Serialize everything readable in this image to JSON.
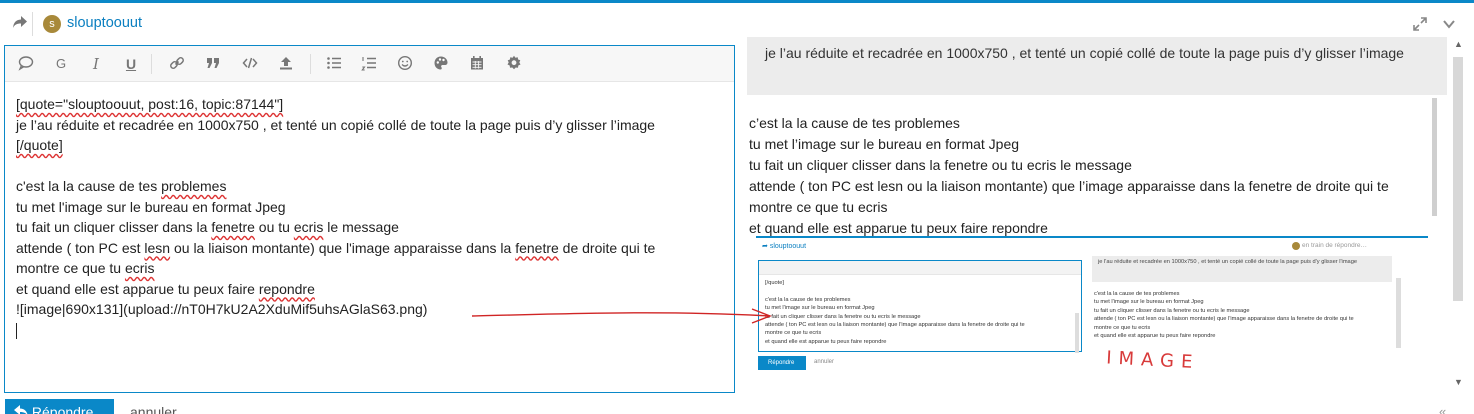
{
  "header": {
    "avatar_letter": "s",
    "username": "slouptoouut",
    "avatar_color": "#a8893a",
    "accent_color": "#0a88c8"
  },
  "toolbar": {
    "icons": [
      "speech-bubble-icon",
      "g-icon",
      "italic-icon",
      "underline-icon",
      "link-icon",
      "quote-icon",
      "code-icon",
      "upload-icon",
      "bullet-list-icon",
      "numbered-list-icon",
      "emoji-icon",
      "palette-icon",
      "calendar-icon",
      "gear-icon"
    ],
    "g_label": "G",
    "italic_label": "I",
    "underline_label": "U"
  },
  "editor": {
    "line_1": "[quote=\"slouptoouut, post:16, topic:87144\"]",
    "line_2": "je l’au réduite et recadrée en 1000x750 , et tenté un copié collé de toute la page puis d’y glisser l’image",
    "line_3": "[/quote]",
    "line_5a": "c'est la la cause de tes ",
    "line_5b": "problemes",
    "line_6": "tu met l'image sur le bureau en format Jpeg",
    "line_7a": "tu fait un cliquer clisser dans la ",
    "line_7b": "fenetre",
    "line_7c": " ou tu ",
    "line_7d": "ecris",
    "line_7e": " le message",
    "line_8a": "attende ( ton PC  est ",
    "line_8b": "lesn",
    "line_8c": " ou la liaison montante) que l'image apparaisse dans la ",
    "line_8d": "fenetre",
    "line_8e": " de droite qui te",
    "line_9a": "montre ce que tu ",
    "line_9b": "ecris",
    "line_10a": "et quand elle est apparue  tu peux faire ",
    "line_10b": "repondre",
    "line_11": "![image|690x131](upload://nT0H7kU2A2XduMif5uhsAGlaS63.png)"
  },
  "preview": {
    "quote_text": "je l’au réduite et recadrée en 1000x750 , et tenté un copié collé de toute la page puis d’y glisser l’image",
    "line_1": "c’est la la cause de tes problemes",
    "line_2": "tu met l’image sur le bureau en format Jpeg",
    "line_3": "tu fait un cliquer clisser dans la fenetre ou tu ecris le message",
    "line_4": "attende ( ton PC est lesn ou la liaison montante) que l’image apparaisse dans la fenetre de droite qui te",
    "line_5": "montre ce que tu ecris",
    "line_6": "et quand elle est apparue tu peux faire repondre"
  },
  "screenshot": {
    "username": "slouptoouut",
    "status": "en train de répondre…",
    "editor_lines": [
      "[/quote]",
      "",
      "c'est la la cause de tes problemes",
      "tu met l'image sur le bureau en format Jpeg",
      "tu fait un cliquer clisser dans la fenetre ou tu ecris le message",
      "attende ( ton PC  est lesn ou la liaison montante) que l'image apparaisse dans la fenetre de droite qui te",
      "montre ce que tu ecris",
      "et quand elle est apparue  tu peux faire repondre"
    ],
    "quote_text": "je l'au réduite et recadrée en 1000x750 , et tenté un copié collé de toute la page puis d'y glisser l'image",
    "preview_lines": [
      "c'est la la cause de tes problemes",
      "tu met l'image sur le bureau en format Jpeg",
      "tu fait un cliquer clisser dans la fenetre ou tu ecris le message",
      "attende ( ton PC est lesn ou la liaison montante) que l'image apparaisse dans la fenetre de droite qui te",
      "montre ce que tu ecris",
      "et quand elle est apparue tu peux faire repondre"
    ],
    "reply_label": "Répondre",
    "cancel_label": "annuler"
  },
  "annotation": {
    "handwritten": "IMAGE",
    "color": "#d83a3a"
  },
  "footer": {
    "reply_label": "Répondre",
    "cancel_label": "annuler"
  }
}
